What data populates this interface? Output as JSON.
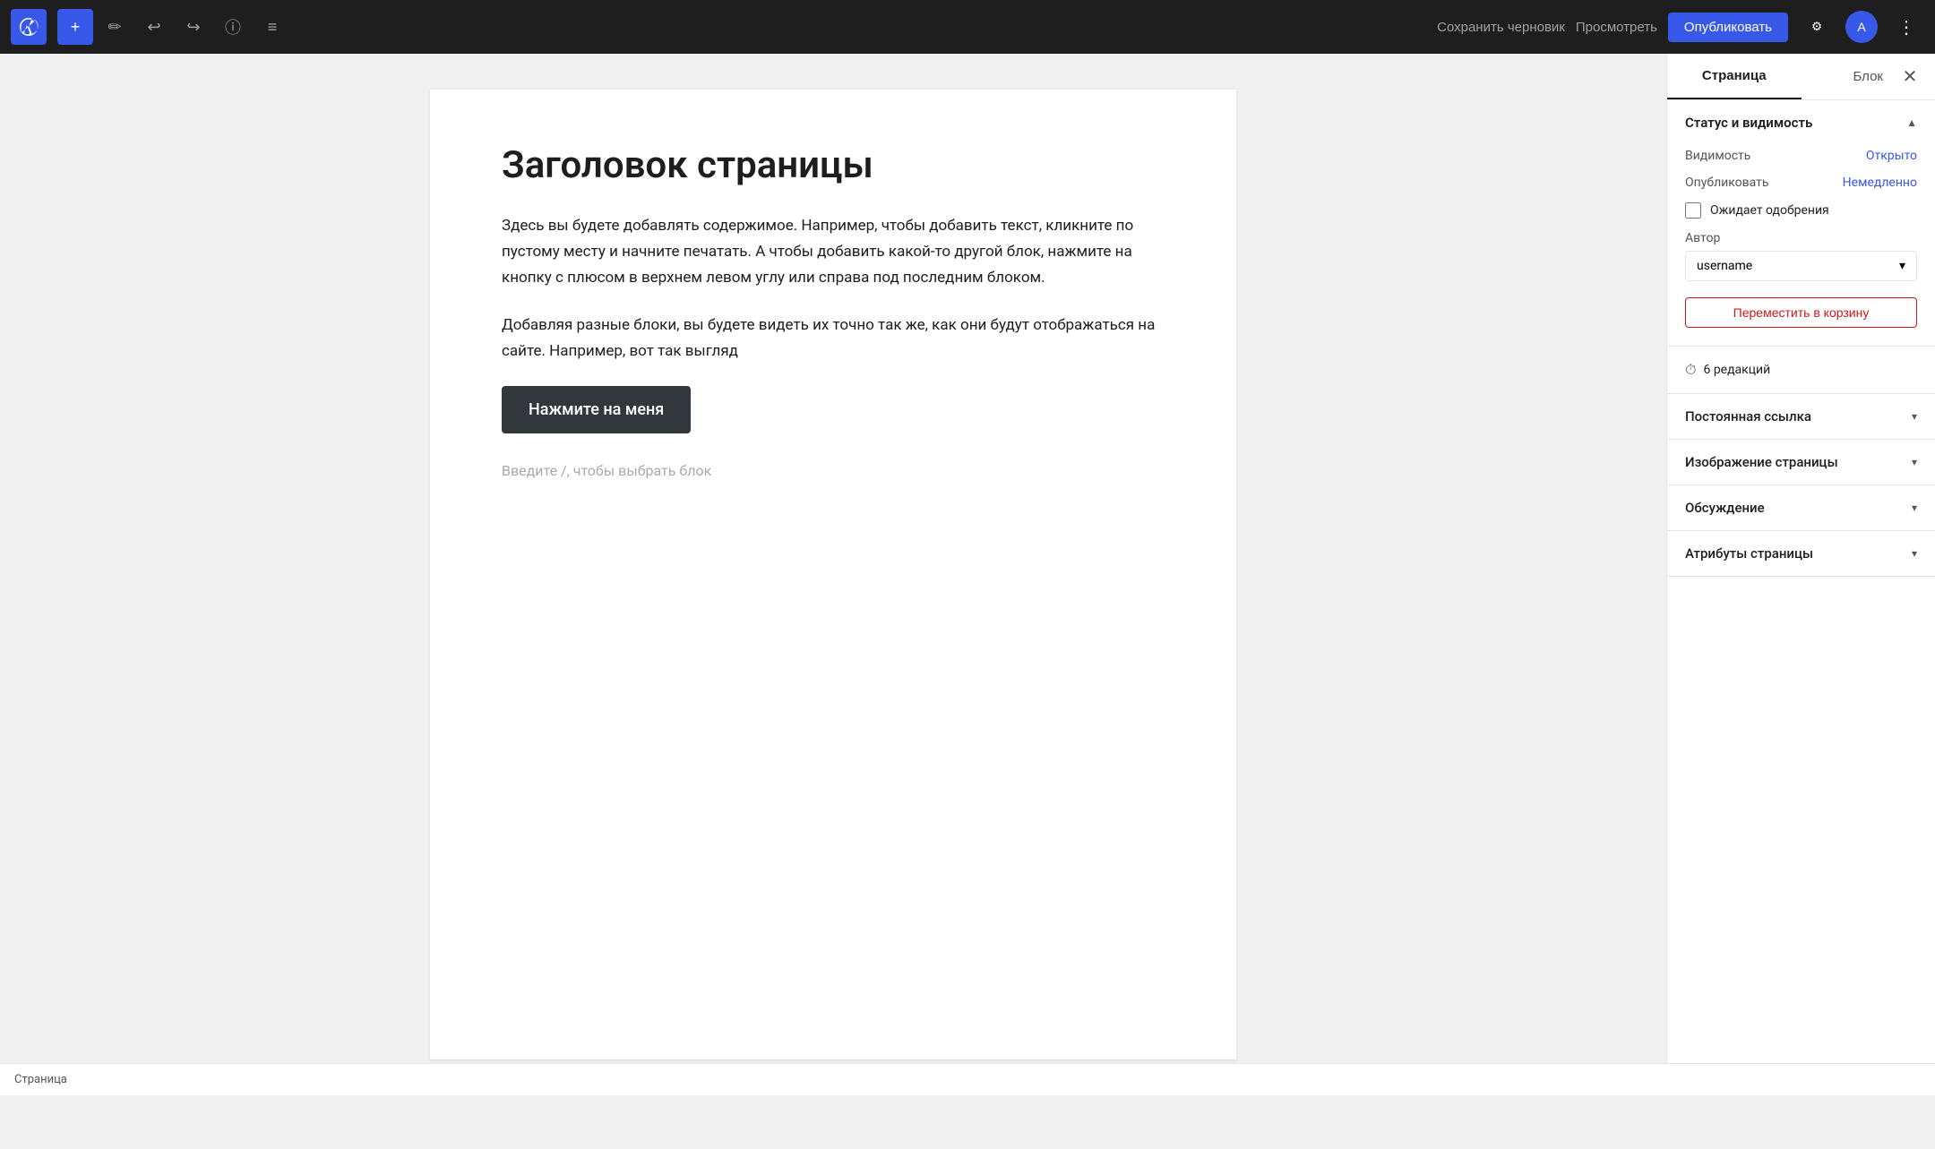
{
  "toolbar": {
    "add_label": "+",
    "save_draft_label": "Сохранить черновик",
    "preview_label": "Просмотреть",
    "publish_label": "Опубликовать",
    "icons": {
      "pencil": "✏",
      "undo": "↩",
      "redo": "↪",
      "info": "ⓘ",
      "list": "≡",
      "settings": "⚙",
      "more": "⋮",
      "close": "✕"
    }
  },
  "editor": {
    "page_title": "Заголовок страницы",
    "body_text_1": "Здесь вы будете добавлять содержимое. Например, чтобы добавить текст, кликните по пустому месту и начните печатать. А чтобы добавить какой-то другой блок, нажмите на кнопку с плюсом в верхнем левом углу или справа под последним блоком.",
    "body_text_2": "Добавляя разные блоки, вы будете видеть их точно так же, как они будут отображаться на сайте. Например, вот так выгляд",
    "button_label": "Нажмите на меня",
    "placeholder": "Введите /, чтобы выбрать блок"
  },
  "sidebar": {
    "tab_page": "Страница",
    "tab_block": "Блок",
    "status_section_title": "Статус и видимость",
    "visibility_label": "Видимость",
    "visibility_value": "Открыто",
    "publish_label": "Опубликовать",
    "publish_value": "Немедленно",
    "pending_label": "Ожидает одобрения",
    "author_label": "Автор",
    "author_value": "username",
    "move_to_trash": "Переместить в корзину",
    "revisions_text": "6 редакций",
    "permalink_title": "Постоянная ссылка",
    "featured_image_title": "Изображение страницы",
    "discussion_title": "Обсуждение",
    "page_attributes_title": "Атрибуты страницы"
  },
  "status_bar": {
    "label": "Страница"
  },
  "colors": {
    "accent": "#3858e9",
    "trash_red": "#cc1818"
  }
}
